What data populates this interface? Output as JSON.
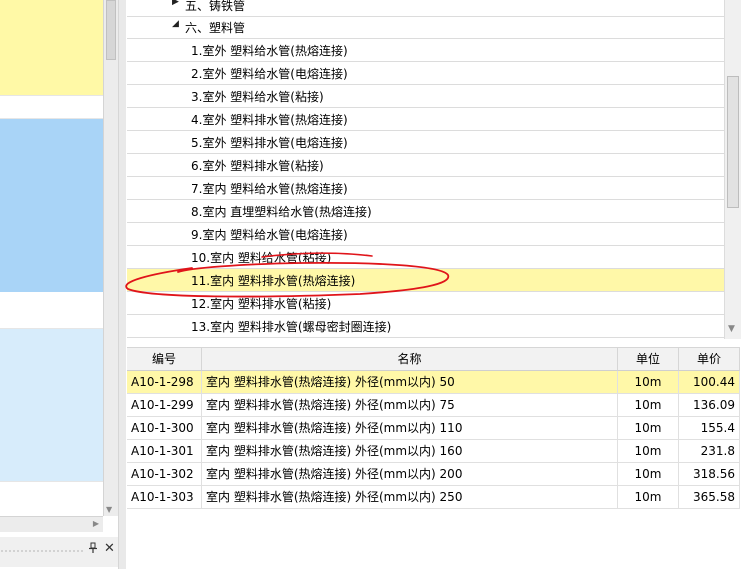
{
  "tree": {
    "items": [
      {
        "label": "五、铸铁管",
        "level": 1,
        "expanded": false
      },
      {
        "label": "六、塑料管",
        "level": 1,
        "expanded": true
      },
      {
        "label": "1.室外 塑料给水管(热熔连接)",
        "level": 2
      },
      {
        "label": "2.室外 塑料给水管(电熔连接)",
        "level": 2
      },
      {
        "label": "3.室外 塑料给水管(粘接)",
        "level": 2
      },
      {
        "label": "4.室外 塑料排水管(热熔连接)",
        "level": 2
      },
      {
        "label": "5.室外 塑料排水管(电熔连接)",
        "level": 2
      },
      {
        "label": "6.室外 塑料排水管(粘接)",
        "level": 2
      },
      {
        "label": "7.室内 塑料给水管(热熔连接)",
        "level": 2
      },
      {
        "label": "8.室内 直埋塑料给水管(热熔连接)",
        "level": 2
      },
      {
        "label": "9.室内 塑料给水管(电熔连接)",
        "level": 2
      },
      {
        "label": "10.室内 塑料给水管(粘接)",
        "level": 2
      },
      {
        "label": "11.室内 塑料排水管(热熔连接)",
        "level": 2,
        "selected": true
      },
      {
        "label": "12.室内 塑料排水管(粘接)",
        "level": 2
      },
      {
        "label": "13.室内 塑料排水管(螺母密封圈连接)",
        "level": 2
      }
    ]
  },
  "table": {
    "headers": {
      "code": "编号",
      "name": "名称",
      "unit": "单位",
      "price": "单价"
    },
    "rows": [
      {
        "code": "A10-1-298",
        "name": "室内 塑料排水管(热熔连接) 外径(mm以内) 50",
        "unit": "10m",
        "price": "100.44",
        "selected": true
      },
      {
        "code": "A10-1-299",
        "name": "室内 塑料排水管(热熔连接) 外径(mm以内) 75",
        "unit": "10m",
        "price": "136.09"
      },
      {
        "code": "A10-1-300",
        "name": "室内 塑料排水管(热熔连接) 外径(mm以内) 110",
        "unit": "10m",
        "price": "155.4"
      },
      {
        "code": "A10-1-301",
        "name": "室内 塑料排水管(热熔连接) 外径(mm以内) 160",
        "unit": "10m",
        "price": "231.8"
      },
      {
        "code": "A10-1-302",
        "name": "室内 塑料排水管(热熔连接) 外径(mm以内) 200",
        "unit": "10m",
        "price": "318.56"
      },
      {
        "code": "A10-1-303",
        "name": "室内 塑料排水管(热熔连接) 外径(mm以内) 250",
        "unit": "10m",
        "price": "365.58"
      }
    ]
  },
  "icons": {
    "tree_collapsed": "triangle-right-icon",
    "tree_expanded": "triangle-down-icon",
    "pin": "pin-icon",
    "close": "close-icon"
  },
  "colors": {
    "selection": "#fff8a8",
    "left_band_yellow": "#fff9a6",
    "left_band_blue": "#a9d4f7",
    "left_band_lightblue": "#d7ecfb",
    "annotation": "#e0141a"
  }
}
